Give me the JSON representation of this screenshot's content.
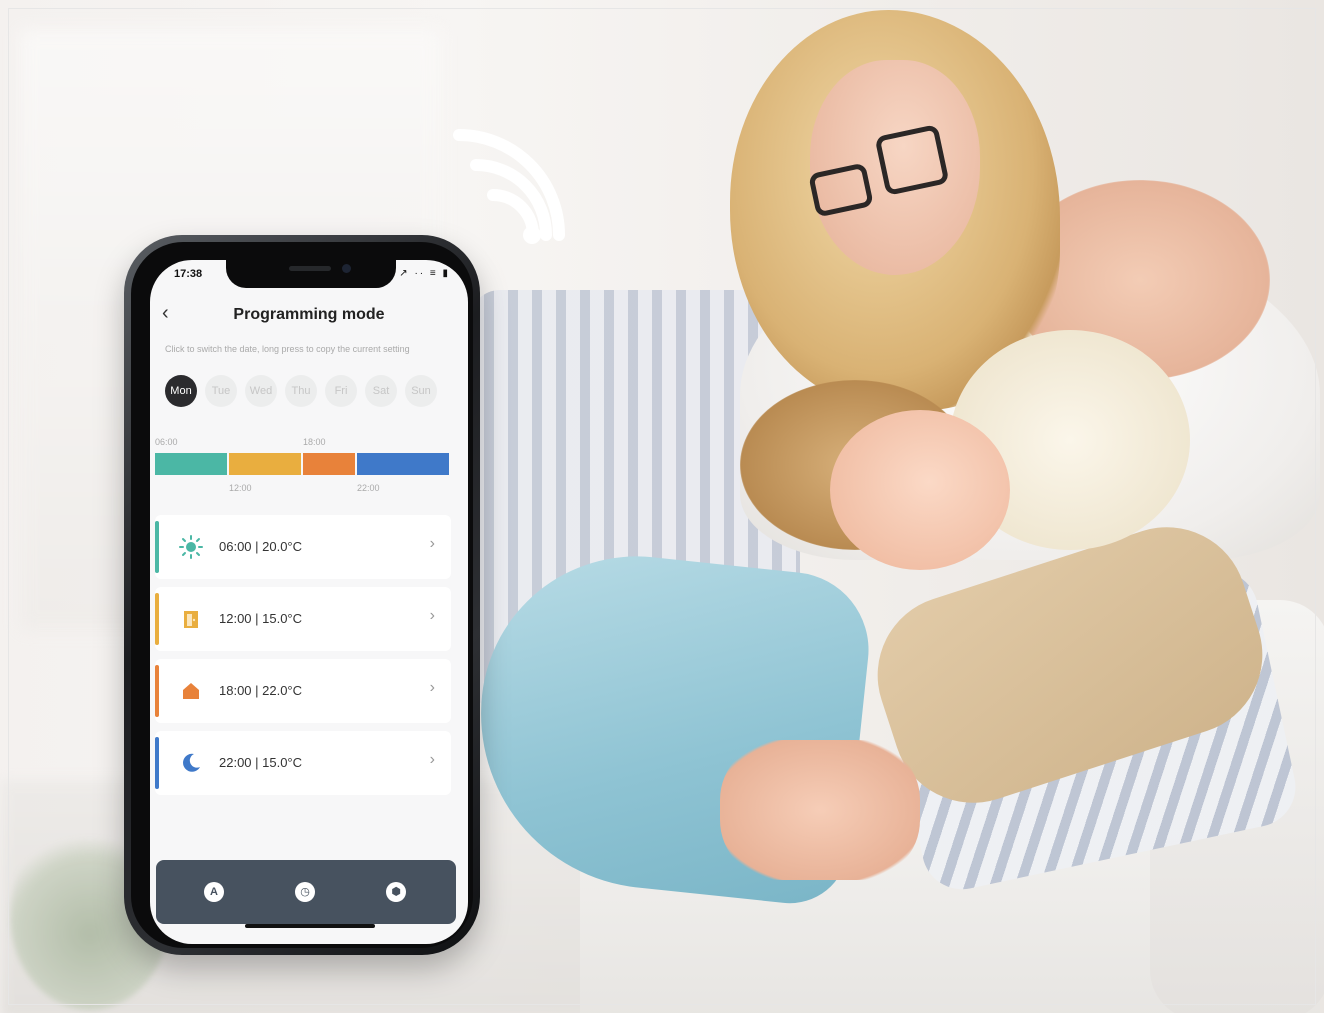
{
  "phone": {
    "status_time": "17:38",
    "status_icons": "↗ ·· ≡ ▮",
    "title": "Programming mode",
    "hint": "Click to switch the date, long press to copy the current setting",
    "days": [
      {
        "label": "Mon",
        "selected": true
      },
      {
        "label": "Tue",
        "selected": false
      },
      {
        "label": "Wed",
        "selected": false
      },
      {
        "label": "Thu",
        "selected": false
      },
      {
        "label": "Fri",
        "selected": false
      },
      {
        "label": "Sat",
        "selected": false
      },
      {
        "label": "Sun",
        "selected": false
      }
    ],
    "timeline": {
      "top_labels": [
        "06:00",
        "18:00"
      ],
      "bottom_labels": [
        "12:00",
        "22:00"
      ],
      "segment_colors": [
        "#4bb7a5",
        "#e9ae3f",
        "#e8823a",
        "#3f79c9"
      ]
    },
    "slots": [
      {
        "text": "06:00  |  20.0°C",
        "icon": "sun-icon",
        "color": "#4bb7a5"
      },
      {
        "text": "12:00  |  15.0°C",
        "icon": "door-icon",
        "color": "#e9ae3f"
      },
      {
        "text": "18:00  |  22.0°C",
        "icon": "home-icon",
        "color": "#e8823a"
      },
      {
        "text": "22:00  |  15.0°C",
        "icon": "moon-icon",
        "color": "#3f79c9"
      }
    ],
    "chevron": "›",
    "back": "‹",
    "tabs": [
      {
        "label": "A",
        "icon": "auto-mode-icon"
      },
      {
        "label": "◷",
        "icon": "clock-icon"
      },
      {
        "label": "⬢",
        "icon": "settings-icon"
      }
    ]
  },
  "colors": {
    "tabbar": "#47525f",
    "day_active": "#2b2b2e"
  }
}
